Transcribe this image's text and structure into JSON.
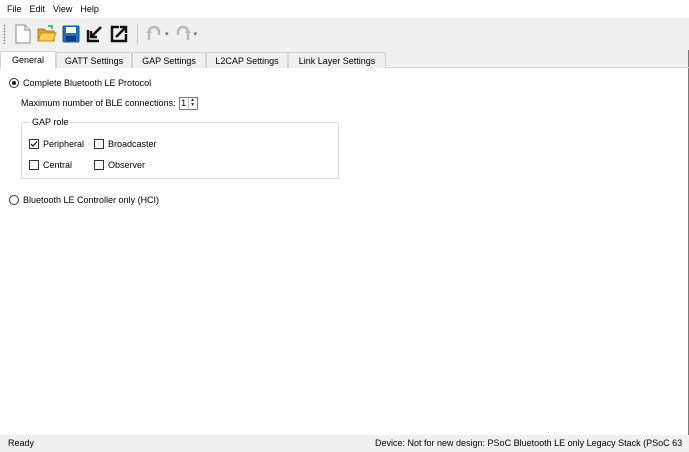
{
  "menu": {
    "items": [
      "File",
      "Edit",
      "View",
      "Help"
    ]
  },
  "toolbar": {
    "buttons": [
      {
        "icon": "new-file-icon"
      },
      {
        "icon": "open-folder-icon"
      },
      {
        "icon": "save-icon"
      },
      {
        "icon": "import-icon"
      },
      {
        "icon": "export-icon"
      },
      {
        "icon": "undo-icon"
      },
      {
        "icon": "redo-icon"
      }
    ]
  },
  "tabs": [
    {
      "label": "General",
      "active": true
    },
    {
      "label": "GATT Settings",
      "active": false
    },
    {
      "label": "GAP Settings",
      "active": false
    },
    {
      "label": "L2CAP Settings",
      "active": false
    },
    {
      "label": "Link Layer Settings",
      "active": false
    }
  ],
  "general": {
    "complete_protocol_label": "Complete Bluetooth LE Protocol",
    "complete_protocol_selected": true,
    "max_connections_label": "Maximum number of BLE connections:",
    "max_connections_value": "1",
    "gap_role": {
      "title": "GAP role",
      "options": [
        {
          "label": "Peripheral",
          "checked": true
        },
        {
          "label": "Broadcaster",
          "checked": false
        },
        {
          "label": "Central",
          "checked": false
        },
        {
          "label": "Observer",
          "checked": false
        }
      ]
    },
    "controller_only_label": "Bluetooth LE Controller only (HCI)",
    "controller_only_selected": false
  },
  "status": {
    "left": "Ready",
    "right": "Device: Not for new design: PSoC Bluetooth LE only Legacy Stack (PSoC 63"
  },
  "colors": {
    "content_bg": "#ffffff",
    "chrome_bg": "#f0f0f0",
    "save_blue": "#1f6fc5",
    "folder_yellow": "#f1c232"
  }
}
